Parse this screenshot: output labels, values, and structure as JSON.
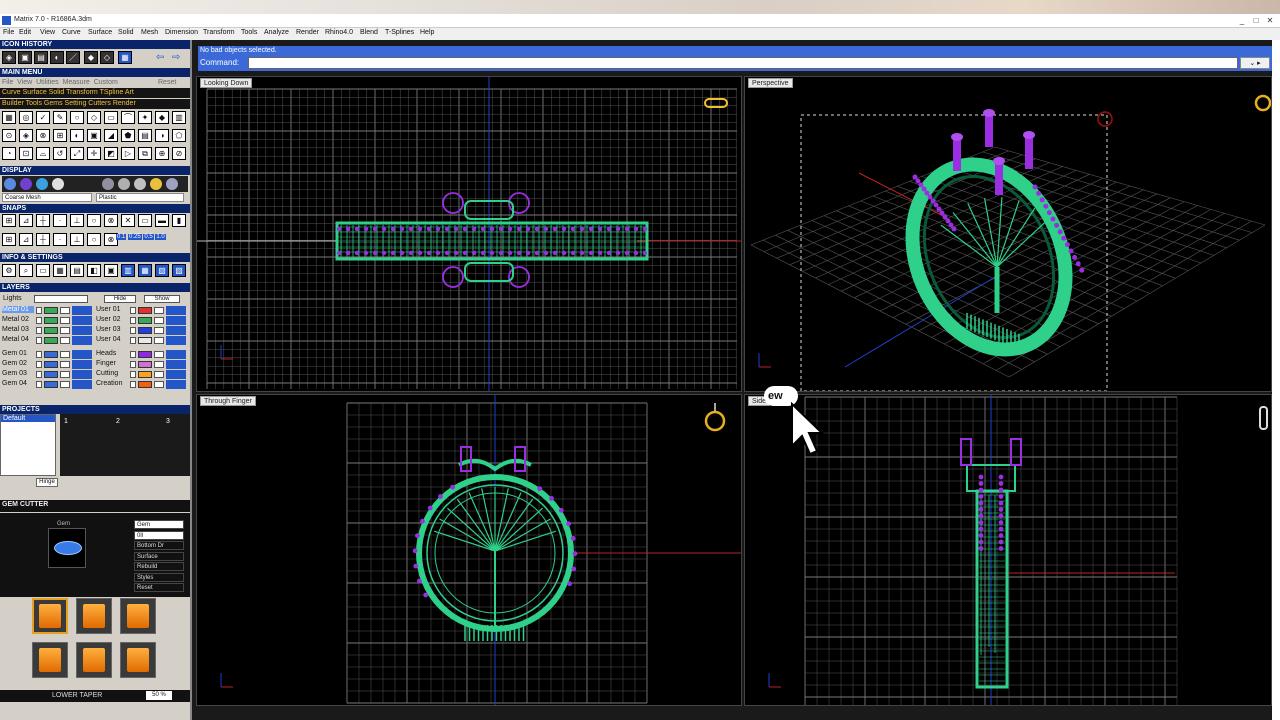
{
  "window": {
    "title": "Matrix 7.0 - R1686A.3dm",
    "controls": [
      "_",
      "□",
      "✕"
    ]
  },
  "menu": [
    "File",
    "Edit",
    "View",
    "Curve",
    "Surface",
    "Solid",
    "Mesh",
    "Dimension",
    "Transform",
    "Tools",
    "Analyze",
    "Render",
    "Rhino4.0",
    "Blend",
    "T-Splines",
    "Help"
  ],
  "left": {
    "icon_history": "ICON HISTORY",
    "main_menu": "MAIN MENU",
    "main_tabs": [
      "File",
      "View",
      "Utilities",
      "Measure",
      "Custom"
    ],
    "reset": "Reset",
    "row1": [
      "Curve",
      "Surface",
      "Solid",
      "Transform",
      "TSpline",
      "Art"
    ],
    "row2": [
      "Builder",
      "Tools",
      "Gems",
      "Setting",
      "Cutters",
      "Render"
    ],
    "display": "DISPLAY",
    "display_mode": "Coarse Mesh",
    "display_mat": "Plastic",
    "snaps": "SNAPS",
    "snap_vals": [
      "0.1",
      "0.25",
      "0.5",
      "1.0"
    ],
    "info": "INFO & SETTINGS",
    "layers": "LAYERS",
    "lights": "Lights",
    "hide": "Hide",
    "show": "Show",
    "layers_left": [
      "Metal 01",
      "Metal 02",
      "Metal 03",
      "Metal 04",
      "Gem 01",
      "Gem 02",
      "Gem 03",
      "Gem 04"
    ],
    "layers_right": [
      "User 01",
      "User 02",
      "User 03",
      "User 04",
      "Heads",
      "Finger",
      "Cutting",
      "Creation"
    ],
    "layer_colors_left": [
      "#3aa85a",
      "#3aa85a",
      "#3aa85a",
      "#3aa85a",
      "#3a6ad8",
      "#3a6ad8",
      "#3a6ad8",
      "#3a6ad8"
    ],
    "layer_colors_right": [
      "#e03030",
      "#3aa85a",
      "#2040e0",
      "#e8e8e8",
      "#8a2be2",
      "#d070d0",
      "#ffa020",
      "#f06010"
    ],
    "projects": "PROJECTS",
    "project_default": "Default",
    "project_slots": [
      "1",
      "2",
      "3"
    ],
    "hinge": "Hinge",
    "gem_cutter": "GEM CUTTER",
    "gem_label": "Gem",
    "gem_fields": [
      "Gem",
      "0ll",
      "Bottom Dr",
      "Surface",
      "Rebuild",
      "Styles",
      "Reset"
    ],
    "taper_label": "LOWER TAPER",
    "taper_value": "50 %"
  },
  "status": {
    "message": "No bad objects selected.",
    "command_label": "Command:"
  },
  "viewports": {
    "top": "Looking Down",
    "persp": "Perspective",
    "front": "Through Finger",
    "side": "Side",
    "tooltip": "ew"
  },
  "colors": {
    "grid": "#555",
    "grid_major": "#7a7a7a",
    "ring": "#2fd08a",
    "gem": "#9a2ee0",
    "axis_red": "#c02020",
    "axis_blue": "#2040d0"
  }
}
